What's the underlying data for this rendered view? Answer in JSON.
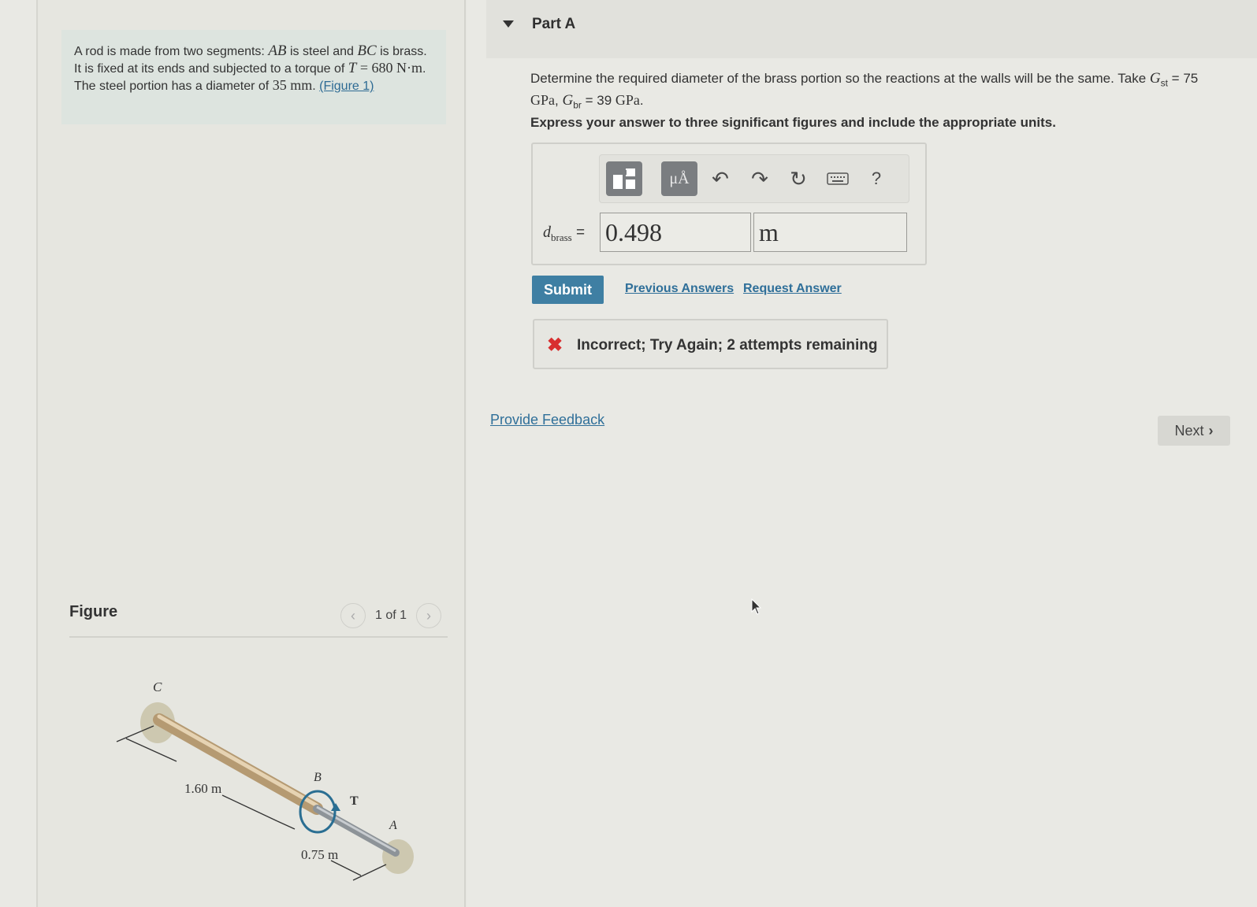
{
  "problem": {
    "text_1": "A rod is made from two segments: ",
    "seg_ab": "AB",
    "text_2": " is steel and ",
    "seg_bc": "BC",
    "text_3": " is brass. It is fixed at its ends and subjected to a torque of ",
    "torque_symbol": "T",
    "torque_eq": " = ",
    "torque_value": "680 N·m",
    "text_4": ". The steel portion has a diameter of ",
    "diameter_value": "35 mm",
    "text_5": ". ",
    "figure_link": "(Figure 1)"
  },
  "figure": {
    "title": "Figure",
    "pager": "1 of 1",
    "prev_icon": "chevron-left-icon",
    "next_icon": "chevron-right-icon",
    "label_c": "C",
    "label_b": "B",
    "label_a": "A",
    "label_t": "T",
    "length_bc": "1.60 m",
    "length_ab": "0.75 m"
  },
  "part": {
    "title": "Part A",
    "question_1": "Determine the required diameter of the brass portion so the reactions at the walls will be the same. Take ",
    "g_symbol": "G",
    "g_st_sub": "st",
    "g_st_eq": " = 75",
    "g_st_unit": "GPa",
    "sep": ", ",
    "g_br_sub": "br",
    "g_br_eq": " = 39 ",
    "g_br_unit": "GPa",
    "end": ".",
    "instruction": "Express your answer to three significant figures and include the appropriate units."
  },
  "toolbar": {
    "templates_icon": "templates-icon",
    "units_label": "μÅ",
    "undo_icon": "undo-icon",
    "redo_icon": "redo-icon",
    "reset_icon": "reset-icon",
    "keyboard_icon": "keyboard-icon",
    "help_label": "?"
  },
  "answer": {
    "var_symbol": "d",
    "var_sub": "brass",
    "equals": " =",
    "value": "0.498",
    "unit": "m"
  },
  "actions": {
    "submit": "Submit",
    "previous_answers": "Previous Answers",
    "request_answer": "Request Answer"
  },
  "feedback": {
    "icon": "x-icon",
    "text": "Incorrect; Try Again; 2 attempts remaining",
    "error_color": "#d82f2f"
  },
  "footer": {
    "provide_feedback": "Provide Feedback",
    "next": "Next"
  }
}
